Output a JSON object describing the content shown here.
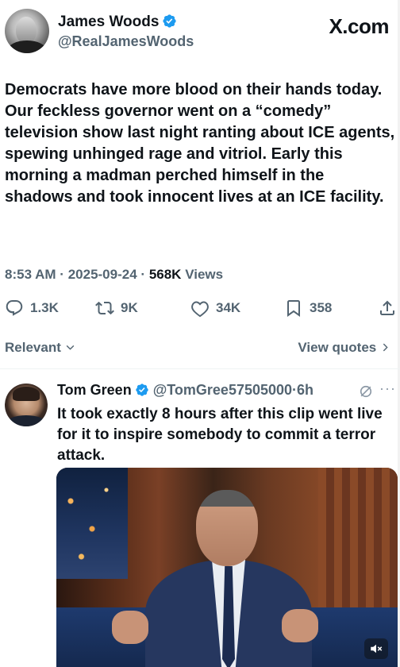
{
  "main_tweet": {
    "author_name": "James Woods",
    "author_handle": "@RealJamesWoods",
    "site_logo": "X.com",
    "text": "Democrats have more blood on their hands today. Our feckless governor went on a “comedy” television show last night ranting about ICE agents, spewing unhinged rage and vitriol. Early this morning a madman perched himself in the shadows and took innocent lives at an ICE facility.",
    "time": "8:53 AM",
    "date": "2025-09-24",
    "views_count": "568K",
    "views_label": "Views",
    "separator": "·",
    "actions": {
      "replies": "1.3K",
      "reposts": "9K",
      "likes": "34K",
      "bookmarks": "358"
    }
  },
  "replies_bar": {
    "sort_label": "Relevant",
    "view_quotes_label": "View quotes"
  },
  "reply": {
    "author_name": "Tom Green",
    "author_handle": "@TomGree57505000",
    "separator": "·",
    "age": "6h",
    "more_label": "···",
    "text": "It took exactly 8 hours after this clip went live for it to inspire somebody to commit a terror attack."
  },
  "icons": {
    "verified": "verified-badge-icon",
    "reply": "reply-icon",
    "repost": "repost-icon",
    "like": "heart-icon",
    "bookmark": "bookmark-icon",
    "share": "share-icon",
    "grok": "grok-icon",
    "mute": "mute-icon"
  },
  "colors": {
    "text_primary": "#0f1419",
    "text_secondary": "#536471",
    "verified_blue": "#1d9bf0"
  }
}
